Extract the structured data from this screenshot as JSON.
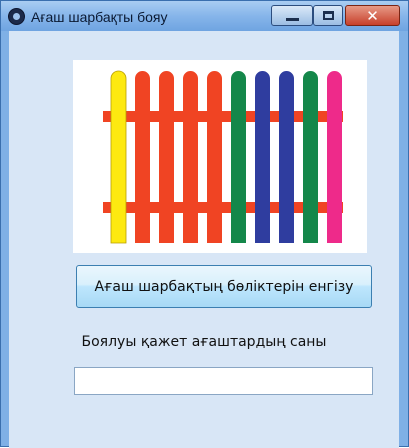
{
  "window": {
    "title": "Ағаш шарбақты  бояу",
    "controls": {
      "minimize": "minimize",
      "maximize": "maximize",
      "close": "close"
    }
  },
  "image": {
    "description_icon": "fence-image",
    "picket_colors": [
      "#fde910",
      "#f04423",
      "#f04423",
      "#f04423",
      "#f04423",
      "#14874a",
      "#2f3d9f",
      "#2f3d9f",
      "#14874a",
      "#ee2a8a"
    ],
    "rail_color": "#f04423"
  },
  "button": {
    "label": "Ағаш шарбақтың  бөліктерін енгізу"
  },
  "count": {
    "label": "Боялуы қажет ағаштардың саны",
    "value": "",
    "placeholder": ""
  }
}
